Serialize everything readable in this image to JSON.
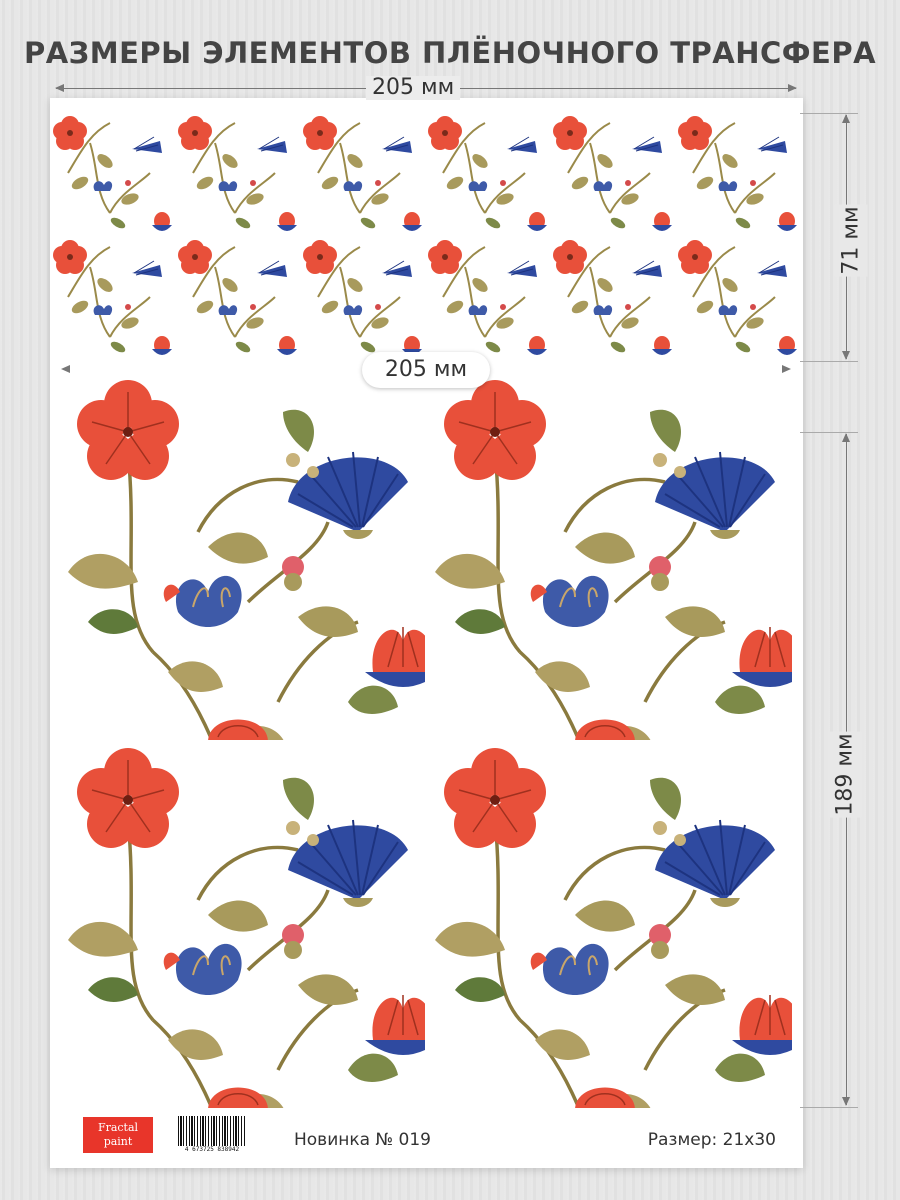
{
  "header": {
    "title": "РАЗМЕРЫ ЭЛЕМЕНТОВ ПЛЁНОЧНОГО ТРАНСФЕРА"
  },
  "dimensions": {
    "top_width": "205 мм",
    "strip_height": "71 мм",
    "big_width": "205 мм",
    "big_height": "189 мм"
  },
  "footer": {
    "brand_line1": "Fractal",
    "brand_line2": "paint",
    "barcode_number": "4 673725 838942",
    "novelty": "Новинка № 019",
    "size": "Размер: 21х30"
  },
  "colors": {
    "flower_red": "#e8503a",
    "flower_blue": "#2f4aa0",
    "leaf_olive": "#a89a5c",
    "leaf_green": "#5f7a3a",
    "brand_red": "#e8352a"
  }
}
